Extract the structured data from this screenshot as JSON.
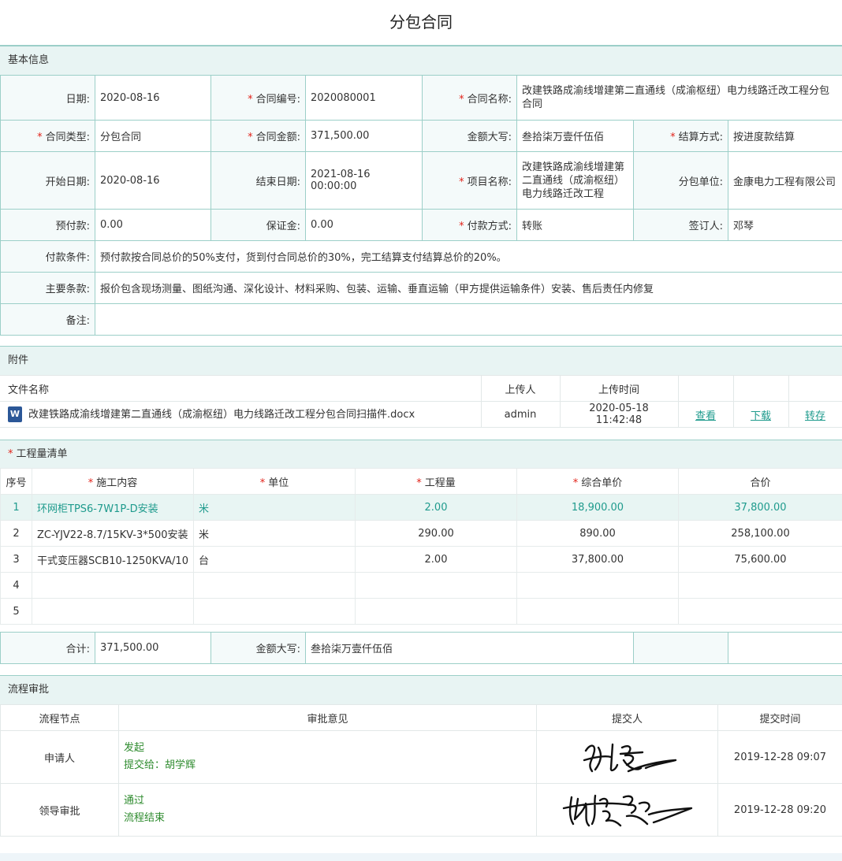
{
  "page": {
    "title": "分包合同"
  },
  "sections": {
    "basic": "基本信息",
    "attachments": "附件",
    "quantities": "工程量清单",
    "flow": "流程审批"
  },
  "basic": {
    "date_label": "日期:",
    "date": "2020-08-16",
    "contract_no_label": "合同编号:",
    "contract_no": "2020080001",
    "contract_name_label": "合同名称:",
    "contract_name": "改建铁路成渝线增建第二直通线（成渝枢纽）电力线路迁改工程分包合同",
    "contract_type_label": "合同类型:",
    "contract_type": "分包合同",
    "amount_label": "合同金额:",
    "amount": "371,500.00",
    "amount_upper_label": "金额大写:",
    "amount_upper": "叁拾柒万壹仟伍佰",
    "settle_label": "结算方式:",
    "settle": "按进度款结算",
    "start_label": "开始日期:",
    "start": "2020-08-16",
    "end_label": "结束日期:",
    "end": "2021-08-16 00:00:00",
    "project_label": "项目名称:",
    "project": "改建铁路成渝线增建第二直通线（成渝枢纽）电力线路迁改工程",
    "sub_unit_label": "分包单位:",
    "sub_unit": "金康电力工程有限公司",
    "prepay_label": "预付款:",
    "prepay": "0.00",
    "deposit_label": "保证金:",
    "deposit": "0.00",
    "pay_method_label": "付款方式:",
    "pay_method": "转账",
    "signer_label": "签订人:",
    "signer": "邓琴",
    "pay_terms_label": "付款条件:",
    "pay_terms": "预付款按合同总价的50%支付，货到付合同总价的30%，完工结算支付结算总价的20%。",
    "main_terms_label": "主要条款:",
    "main_terms": "报价包含现场测量、图纸沟通、深化设计、材料采购、包装、运输、垂直运输（甲方提供运输条件）安装、售后责任内修复",
    "remark_label": "备注:",
    "remark": ""
  },
  "attachments": {
    "headers": {
      "name": "文件名称",
      "uploader": "上传人",
      "time": "上传时间"
    },
    "rows": [
      {
        "icon": "word-doc-icon",
        "icon_text": "W",
        "name": "改建铁路成渝线增建第二直通线（成渝枢纽）电力线路迁改工程分包合同扫描件.docx",
        "uploader": "admin",
        "time": "2020-05-18 11:42:48",
        "view": "查看",
        "download": "下载",
        "save": "转存"
      }
    ]
  },
  "quantities": {
    "headers": {
      "no": "序号",
      "content": "施工内容",
      "unit": "单位",
      "qty": "工程量",
      "price": "综合单价",
      "total": "合价"
    },
    "rows": [
      {
        "no": "1",
        "content": "环网柜TPS6-7W1P-D安装",
        "unit": "米",
        "qty": "2.00",
        "price": "18,900.00",
        "total": "37,800.00"
      },
      {
        "no": "2",
        "content": "ZC-YJV22-8.7/15KV-3*500安装",
        "unit": "米",
        "qty": "290.00",
        "price": "890.00",
        "total": "258,100.00"
      },
      {
        "no": "3",
        "content": "干式变压器SCB10-1250KVA/10",
        "unit": "台",
        "qty": "2.00",
        "price": "37,800.00",
        "total": "75,600.00"
      },
      {
        "no": "4",
        "content": "",
        "unit": "",
        "qty": "",
        "price": "",
        "total": ""
      },
      {
        "no": "5",
        "content": "",
        "unit": "",
        "qty": "",
        "price": "",
        "total": ""
      }
    ],
    "sum_label": "合计:",
    "sum": "371,500.00",
    "sum_upper_label": "金额大写:",
    "sum_upper": "叁拾柒万壹仟伍佰"
  },
  "flow": {
    "headers": {
      "node": "流程节点",
      "opinion": "审批意见",
      "submitter": "提交人",
      "time": "提交时间"
    },
    "rows": [
      {
        "node": "申请人",
        "opinion_1": "发起",
        "opinion_2": "提交给：胡学辉",
        "time": "2019-12-28 09:07"
      },
      {
        "node": "领导审批",
        "opinion_1": "通过",
        "opinion_2": "流程结束",
        "time": "2019-12-28 09:20"
      }
    ]
  },
  "colors": {
    "accent": "#1f9b8d",
    "border": "#9ccfc8",
    "header_bg": "#e8f4f3",
    "required": "#e2231a"
  }
}
